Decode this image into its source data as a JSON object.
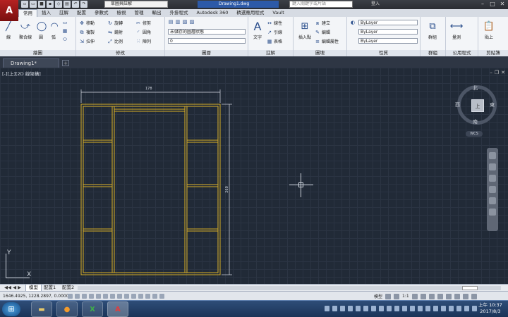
{
  "app": {
    "letter": "A",
    "workspace": "草圖與註解",
    "doc_title": "Drawing1.dwg",
    "search_placeholder": "鍵入關鍵字或片語",
    "login": "登入"
  },
  "ribbon_tabs": [
    "常用",
    "插入",
    "註解",
    "配置",
    "參數式",
    "檢視",
    "管理",
    "輸出",
    "外掛程式",
    "Autodesk 360",
    "精選應用程式",
    "Vault"
  ],
  "panels": {
    "draw": {
      "title": "繪圖",
      "line": "線",
      "polyline": "聚合線",
      "circle": "圓",
      "arc": "弧"
    },
    "modify": {
      "title": "修改",
      "move": "移動",
      "rotate": "旋轉",
      "trim": "修剪",
      "copy": "複製",
      "mirror": "鏡射",
      "fillet": "圓角",
      "stretch": "拉伸",
      "scale": "比例",
      "array": "陣列"
    },
    "layers": {
      "title": "圖層",
      "layer_state": "未儲存的圖層狀態",
      "current_layer": "0"
    },
    "annotation": {
      "title": "註解",
      "text": "文字",
      "dimension": "線性",
      "leader": "引線",
      "table": "表格"
    },
    "block": {
      "title": "圖塊",
      "insert": "插入點",
      "create": "建立",
      "edit": "編輯",
      "edit_attr": "編輯屬性"
    },
    "properties": {
      "title": "性質",
      "color": "ByLayer",
      "linetype": "ByLayer",
      "lineweight": "ByLayer"
    },
    "groups": {
      "title": "群組",
      "group": "群組"
    },
    "utilities": {
      "title": "公用程式",
      "measure": "量測"
    },
    "clipboard": {
      "title": "剪貼簿",
      "paste": "貼上"
    }
  },
  "file_tab": "Drawing1*",
  "viewport": {
    "label": "[-][上][2D 線架構]",
    "compass": {
      "north": "北",
      "south": "南",
      "east": "東",
      "west": "西",
      "face": "上"
    },
    "wcs": "WCS",
    "ucs_x": "X",
    "ucs_y": "Y",
    "dim_top": "178",
    "dim_right": "260"
  },
  "layout_tabs": [
    "模型",
    "配置1",
    "配置2"
  ],
  "status": {
    "coords": "1646.4925, 1228.2897, 0.0000",
    "model": "模型",
    "scale": "1:1"
  },
  "taskbar": {
    "time": "上午 10:37",
    "date": "2017/8/3"
  },
  "colors": {
    "drawing": "#d7ad25",
    "background": "#212a37",
    "accent": "#2d5aa8"
  }
}
